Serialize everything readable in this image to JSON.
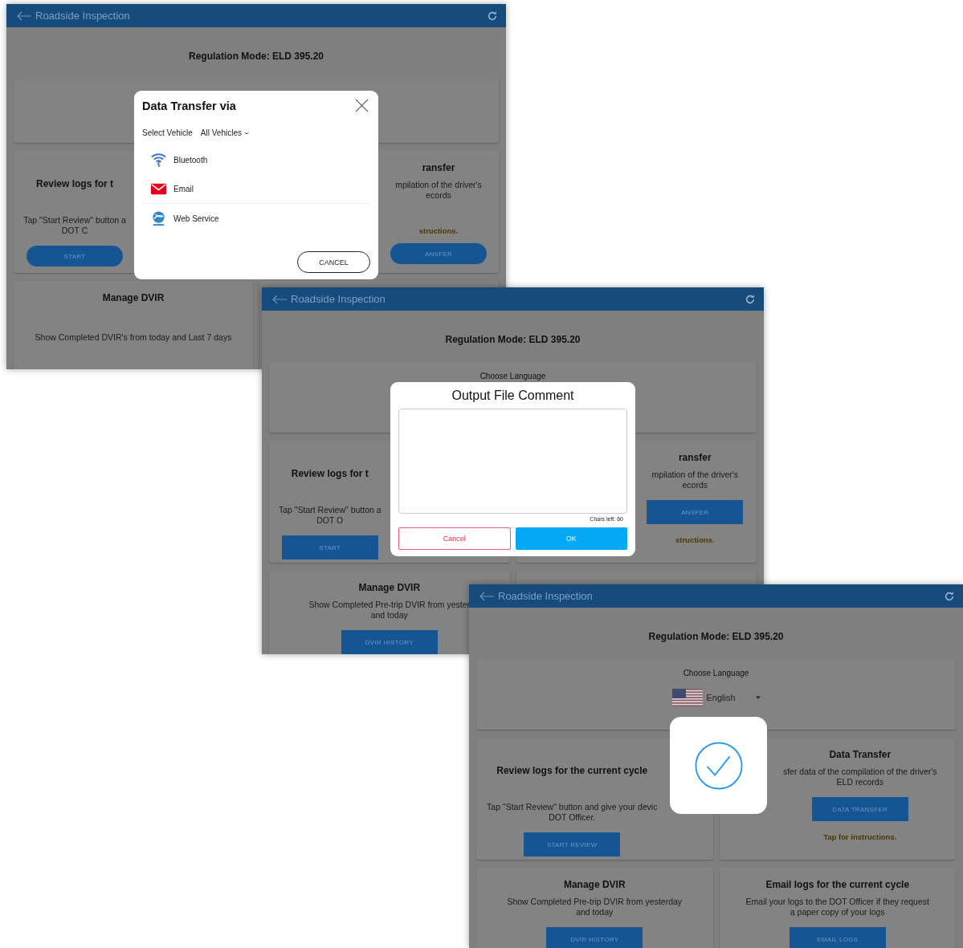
{
  "screens": [
    {
      "title": "Roadside Inspection",
      "regulation": "Regulation Mode: ELD 395.20",
      "cards": [
        {
          "title": "Review logs for t",
          "lines": [
            "Tap \"Start Review\" button a",
            "DOT C"
          ],
          "button": {
            "label": "START"
          }
        },
        {
          "title": "ransfer",
          "lines": [
            "mpilation of the driver's",
            "ecords"
          ],
          "button": {
            "label": "ANSFER"
          },
          "note": "structions."
        },
        {
          "title": "Manage DVIR",
          "lines": [
            "Show Completed DVIR's from today and Last 7 days"
          ]
        }
      ],
      "modal": {
        "kind": "transfer",
        "title": "Data Transfer via",
        "vehicle_label": "Select Vehicle",
        "vehicle_value": "All Vehicles",
        "options": [
          {
            "kind": "bluetooth",
            "label": "Bluetooth"
          },
          {
            "kind": "email",
            "label": "Email"
          },
          {
            "kind": "web",
            "label": "Web Service"
          }
        ],
        "cancel": "CANCEL"
      }
    },
    {
      "title": "Roadside Inspection",
      "regulation": "Regulation Mode: ELD 395.20",
      "language": {
        "label": "Choose Language"
      },
      "cards": [
        {
          "title": "Review logs for t",
          "lines": [
            "Tap \"Start Review\" button a",
            "DOT O"
          ],
          "button": {
            "label": "START"
          }
        },
        {
          "title": "ransfer",
          "lines": [
            "mpilation of the driver's",
            "ecords"
          ],
          "button": {
            "label": "ANSFER"
          },
          "note": "structions."
        },
        {
          "title": "Manage DVIR",
          "lines": [
            "Show Completed Pre-trip DVIR from yester",
            "and today"
          ],
          "button": {
            "label": "DVIR HISTORY"
          }
        }
      ],
      "modal": {
        "kind": "comment",
        "title": "Output File Comment",
        "counter": "Chars left: 60",
        "cancel": "Cancel",
        "ok": "OK"
      }
    },
    {
      "title": "Roadside Inspection",
      "regulation": "Regulation Mode: ELD 395.20",
      "language": {
        "label": "Choose Language",
        "value": "English"
      },
      "cards": [
        {
          "title": "Review logs for the current cycle",
          "lines": [
            "Tap \"Start Review\" button and give your devic",
            "DOT Officer."
          ],
          "button": {
            "label": "START REVIEW"
          }
        },
        {
          "title": "Data Transfer",
          "lines": [
            "sfer data of the compilation of the driver's",
            "ELD records"
          ],
          "button": {
            "label": "DATA TRANSFER"
          },
          "note": "Tap for instructions."
        },
        {
          "title": "Manage DVIR",
          "lines": [
            "Show Completed Pre-trip DVIR from yesterday",
            "and today"
          ],
          "button": {
            "label": "DVIR HISTORY"
          }
        },
        {
          "title": "Email logs for the current cycle",
          "lines": [
            "Email your logs to the DOT Officer if they request",
            "a paper copy of your logs"
          ],
          "button": {
            "label": "EMAIL LOGS"
          }
        }
      ],
      "modal": {
        "kind": "success"
      }
    }
  ]
}
